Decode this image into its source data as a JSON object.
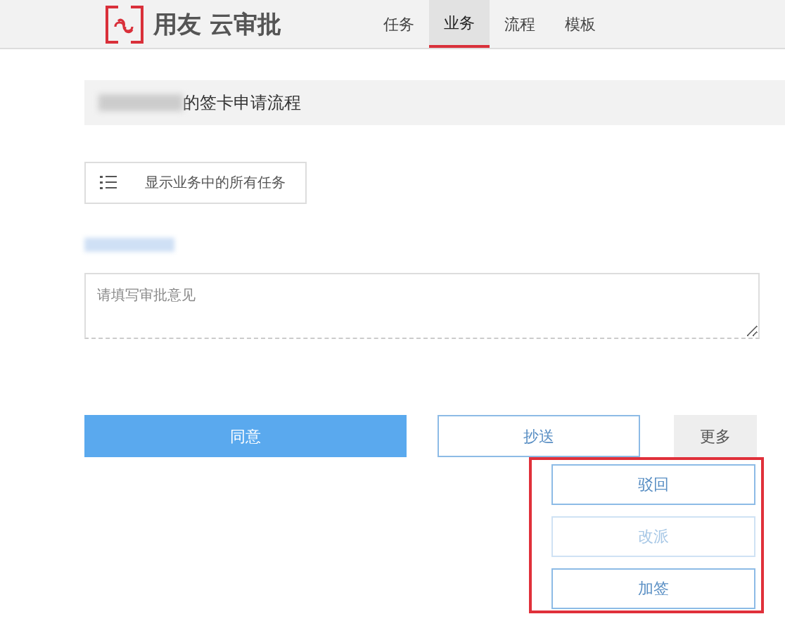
{
  "header": {
    "logo_text": "用友 云审批",
    "tabs": [
      {
        "label": "任务",
        "selected": false
      },
      {
        "label": "业务",
        "selected": true
      },
      {
        "label": "流程",
        "selected": false
      },
      {
        "label": "模板",
        "selected": false
      }
    ]
  },
  "title_bar": {
    "title": "的签卡申请流程"
  },
  "show_all_button": {
    "label": "显示业务中的所有任务"
  },
  "comment": {
    "placeholder": "请填写审批意见"
  },
  "actions": {
    "agree": "同意",
    "cc": "抄送",
    "more": "更多"
  },
  "more_menu": [
    {
      "label": "驳回",
      "disabled": false
    },
    {
      "label": "改派",
      "disabled": true
    },
    {
      "label": "加签",
      "disabled": false
    }
  ]
}
